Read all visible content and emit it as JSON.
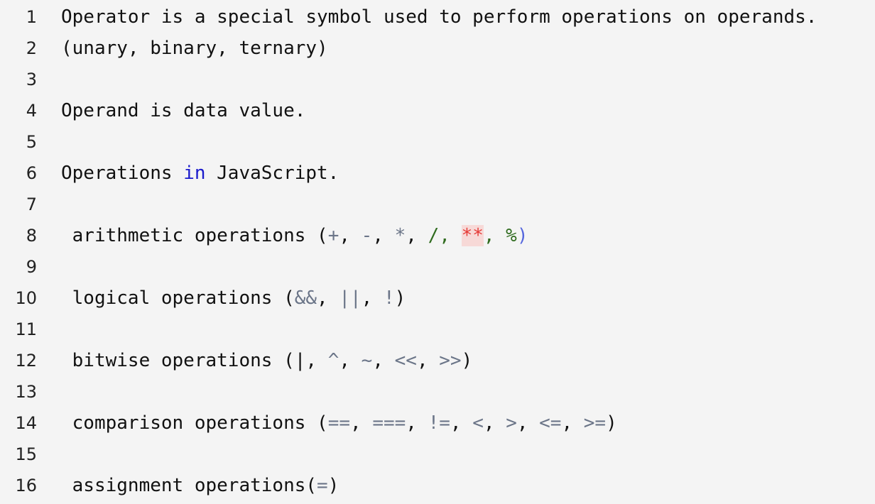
{
  "lines": [
    {
      "number": "1",
      "tokens": [
        {
          "text": "Operator is a special symbol used to perform operations on operands.",
          "type": "text"
        }
      ]
    },
    {
      "number": "2",
      "tokens": [
        {
          "text": "(unary, binary, ternary)",
          "type": "text"
        }
      ]
    },
    {
      "number": "3",
      "tokens": []
    },
    {
      "number": "4",
      "tokens": [
        {
          "text": "Operand is data value.",
          "type": "text"
        }
      ]
    },
    {
      "number": "5",
      "tokens": []
    },
    {
      "number": "6",
      "tokens": [
        {
          "text": "Operations ",
          "type": "text"
        },
        {
          "text": "in",
          "type": "kw"
        },
        {
          "text": " JavaScript.",
          "type": "text"
        }
      ]
    },
    {
      "number": "7",
      "tokens": []
    },
    {
      "number": "8",
      "tokens": [
        {
          "text": " arithmetic operations (",
          "type": "text"
        },
        {
          "text": "+",
          "type": "op"
        },
        {
          "text": ", ",
          "type": "text"
        },
        {
          "text": "-",
          "type": "op"
        },
        {
          "text": ", ",
          "type": "text"
        },
        {
          "text": "*",
          "type": "op"
        },
        {
          "text": ", ",
          "type": "text"
        },
        {
          "text": "/, ",
          "type": "str"
        },
        {
          "text": "**",
          "type": "err"
        },
        {
          "text": ", %",
          "type": "str"
        },
        {
          "text": ")",
          "type": "paren-close"
        }
      ]
    },
    {
      "number": "9",
      "tokens": []
    },
    {
      "number": "10",
      "tokens": [
        {
          "text": " logical operations (",
          "type": "text"
        },
        {
          "text": "&&",
          "type": "op"
        },
        {
          "text": ", ",
          "type": "text"
        },
        {
          "text": "||",
          "type": "op"
        },
        {
          "text": ", ",
          "type": "text"
        },
        {
          "text": "!",
          "type": "op"
        },
        {
          "text": ")",
          "type": "text"
        }
      ]
    },
    {
      "number": "11",
      "tokens": []
    },
    {
      "number": "12",
      "tokens": [
        {
          "text": " bitwise operations (|, ",
          "type": "text"
        },
        {
          "text": "^",
          "type": "op"
        },
        {
          "text": ", ",
          "type": "text"
        },
        {
          "text": "~",
          "type": "op"
        },
        {
          "text": ", ",
          "type": "text"
        },
        {
          "text": "<<",
          "type": "op"
        },
        {
          "text": ", ",
          "type": "text"
        },
        {
          "text": ">>",
          "type": "op"
        },
        {
          "text": ")",
          "type": "text"
        }
      ]
    },
    {
      "number": "13",
      "tokens": []
    },
    {
      "number": "14",
      "tokens": [
        {
          "text": " comparison operations (",
          "type": "text"
        },
        {
          "text": "==",
          "type": "op"
        },
        {
          "text": ", ",
          "type": "text"
        },
        {
          "text": "===",
          "type": "op"
        },
        {
          "text": ", ",
          "type": "text"
        },
        {
          "text": "!=",
          "type": "op"
        },
        {
          "text": ", ",
          "type": "text"
        },
        {
          "text": "<",
          "type": "op"
        },
        {
          "text": ", ",
          "type": "text"
        },
        {
          "text": ">",
          "type": "op"
        },
        {
          "text": ", ",
          "type": "text"
        },
        {
          "text": "<=",
          "type": "op"
        },
        {
          "text": ", ",
          "type": "text"
        },
        {
          "text": ">=",
          "type": "op"
        },
        {
          "text": ")",
          "type": "text"
        }
      ]
    },
    {
      "number": "15",
      "tokens": []
    },
    {
      "number": "16",
      "tokens": [
        {
          "text": " assignment operations(",
          "type": "text"
        },
        {
          "text": "=",
          "type": "op"
        },
        {
          "text": ")",
          "type": "text"
        }
      ]
    }
  ],
  "colors": {
    "background": "#f4f4f4",
    "text": "#111111",
    "keyword": "#1a1acc",
    "operator": "#6b7588",
    "string": "#2f6b1e",
    "error": "#e53935",
    "error_background": "#f7d9d7"
  }
}
